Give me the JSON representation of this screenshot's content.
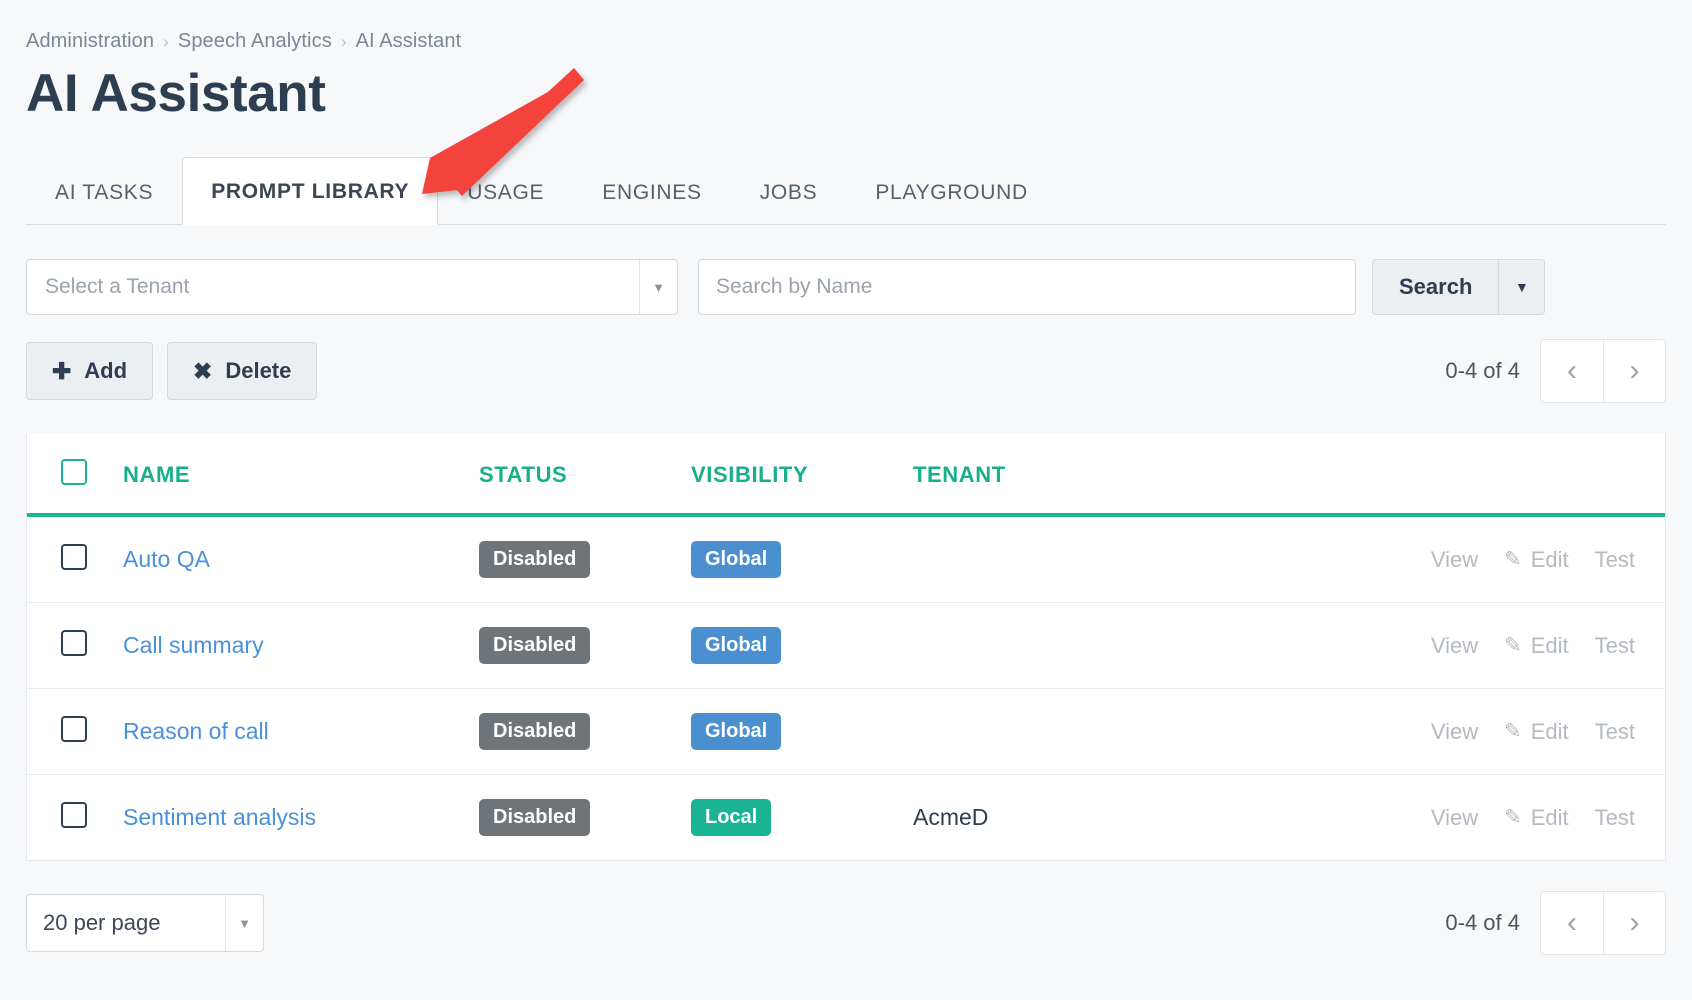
{
  "breadcrumb": {
    "items": [
      {
        "label": "Administration"
      },
      {
        "label": "Speech Analytics"
      },
      {
        "label": "AI Assistant"
      }
    ],
    "separator": "›"
  },
  "page": {
    "title": "AI Assistant"
  },
  "tabs": [
    {
      "label": "AI TASKS",
      "active": false
    },
    {
      "label": "PROMPT LIBRARY",
      "active": true
    },
    {
      "label": "USAGE",
      "active": false
    },
    {
      "label": "ENGINES",
      "active": false
    },
    {
      "label": "JOBS",
      "active": false
    },
    {
      "label": "PLAYGROUND",
      "active": false
    }
  ],
  "filters": {
    "tenant_select": {
      "value": "Select a Tenant",
      "caret": "▼"
    },
    "search": {
      "value": "",
      "placeholder": "Search by Name"
    },
    "search_button": {
      "label": "Search",
      "caret": "▼"
    }
  },
  "toolbar": {
    "add_label": "Add",
    "add_glyph": "✚",
    "delete_label": "Delete",
    "delete_glyph": "✖"
  },
  "pagination_top": {
    "range": "0-4 of 4",
    "prev": "‹",
    "next": "›"
  },
  "table": {
    "columns": [
      {
        "key": "name",
        "label": "NAME"
      },
      {
        "key": "status",
        "label": "STATUS"
      },
      {
        "key": "visibility",
        "label": "VISIBILITY"
      },
      {
        "key": "tenant",
        "label": "TENANT"
      }
    ],
    "actions": {
      "view": "View",
      "edit": "Edit",
      "edit_icon": "✎",
      "test": "Test"
    },
    "rows": [
      {
        "name": "Auto QA",
        "status": "Disabled",
        "visibility": "Global",
        "visibility_kind": "global",
        "tenant": ""
      },
      {
        "name": "Call summary",
        "status": "Disabled",
        "visibility": "Global",
        "visibility_kind": "global",
        "tenant": ""
      },
      {
        "name": "Reason of call",
        "status": "Disabled",
        "visibility": "Global",
        "visibility_kind": "global",
        "tenant": ""
      },
      {
        "name": "Sentiment analysis",
        "status": "Disabled",
        "visibility": "Local",
        "visibility_kind": "local",
        "tenant": "AcmeD"
      }
    ]
  },
  "footer": {
    "per_page": {
      "value": "20 per page",
      "caret": "▼"
    },
    "pagination": {
      "range": "0-4 of 4",
      "prev": "‹",
      "next": "›"
    }
  },
  "colors": {
    "accent_teal": "#1ab394",
    "link_blue": "#4a90d9",
    "badge_gray": "#6e7478",
    "badge_blue": "#4a8fd0",
    "annotation_red": "#f4433c",
    "title_dark": "#2c3e50"
  },
  "annotation": {
    "kind": "arrow",
    "color": "#f4433c",
    "points_to": "PROMPT LIBRARY"
  }
}
